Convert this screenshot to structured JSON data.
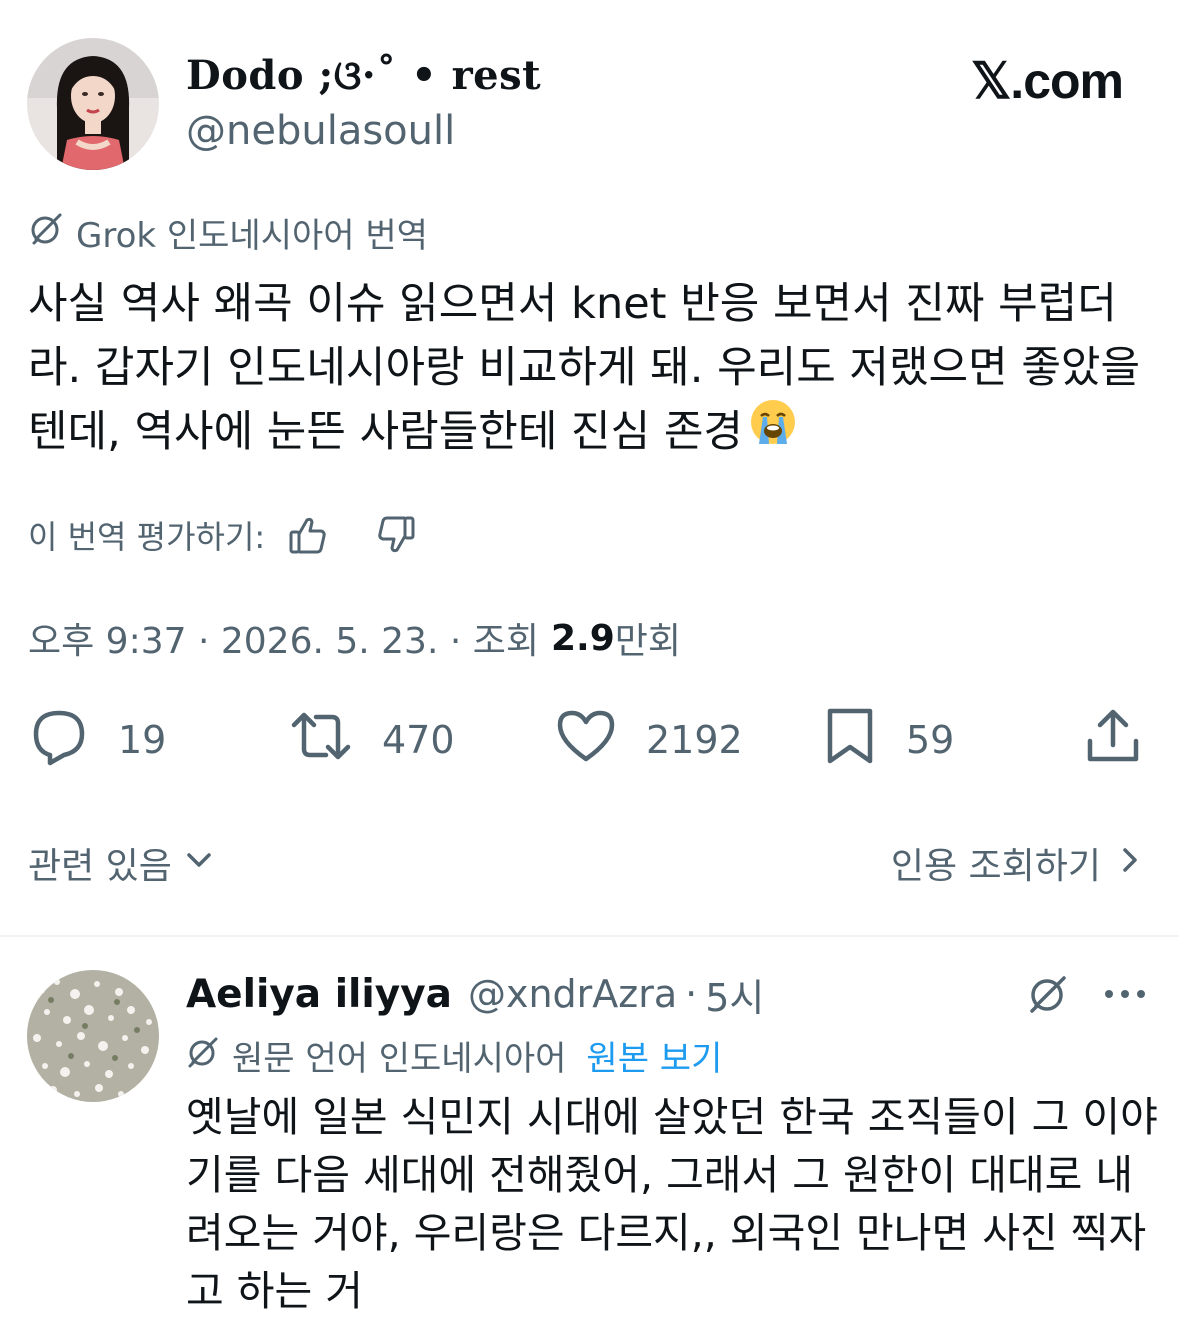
{
  "tweet": {
    "display_name": "Dodo ;ଓ·˚ • rest",
    "handle": "@nebulasoull",
    "site_logo": "𝕏.com",
    "translation_label": "Grok 인도네시아어 번역",
    "text": "사실 역사 왜곡 이슈 읽으면서 knet 반응 보면서 진짜 부럽더라. 갑자기 인도네시아랑 비교하게 돼. 우리도 저랬으면 좋았을 텐데, 역사에 눈뜬 사람들한테 진심 존경",
    "emoji": "loudly-crying-face",
    "rate_label": "이 번역 평가하기:",
    "meta_prefix": "오후 9:37 · 2026. 5. 23. · 조회",
    "views": "2.9",
    "views_unit": "만회",
    "actions": {
      "replies": "19",
      "retweets": "470",
      "likes": "2192",
      "bookmarks": "59"
    },
    "related_label": "관련 있음",
    "view_quotes_label": "인용 조회하기"
  },
  "reply": {
    "name": "Aeliya iliyya",
    "handle": "@xndrAzra",
    "dot": "·",
    "time": "5시",
    "lang_label": "원문 언어 인도네시아어",
    "view_original": "원본 보기",
    "text": "옛날에 일본 식민지 시대에 살았던 한국 조직들이 그 이야기를 다음 세대에 전해줬어, 그래서 그 원한이 대대로 내려오는 거야, 우리랑은 다르지,, 외국인 만나면 사진 찍자고 하는 거"
  },
  "colors": {
    "text": "#0f1419",
    "secondary": "#536471",
    "link": "#1d9bf0",
    "divider": "#eff3f4"
  },
  "icons": [
    "grok-icon",
    "thumbs-up-icon",
    "thumbs-down-icon",
    "reply-icon",
    "retweet-icon",
    "like-icon",
    "bookmark-icon",
    "share-icon",
    "chevron-down-icon",
    "chevron-right-icon",
    "more-icon"
  ]
}
